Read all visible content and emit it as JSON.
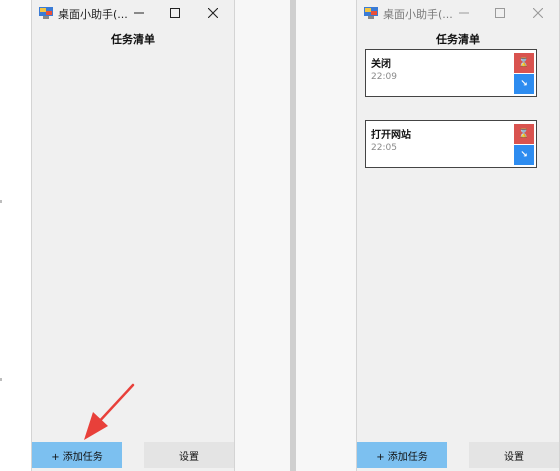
{
  "window_left": {
    "title": "桌面小助手(...",
    "heading": "任务清单",
    "tasks": [],
    "add_button": "+ 添加任务",
    "settings_button": "设置"
  },
  "window_right": {
    "title": "桌面小助手(...",
    "heading": "任务清单",
    "tasks": [
      {
        "title": "关闭",
        "time": "22:09",
        "delete_glyph": "⌛",
        "edit_glyph": "↘"
      },
      {
        "title": "打开网站",
        "time": "22:05",
        "delete_glyph": "⌛",
        "edit_glyph": "↘"
      }
    ],
    "add_button": "+ 添加任务",
    "settings_button": "设置"
  },
  "icons": {
    "app": "app-icon",
    "minimize": "minimize-icon",
    "maximize": "maximize-icon",
    "close": "close-icon",
    "pointer_arrow": "red-arrow-annotation"
  },
  "colors": {
    "window_bg": "#f0f0f0",
    "add_button_bg": "#7cc0f0",
    "settings_button_bg": "#e4e4e4",
    "delete_button_bg": "#d9534f",
    "edit_button_bg": "#2d8cf0",
    "arrow": "#e8403a"
  }
}
